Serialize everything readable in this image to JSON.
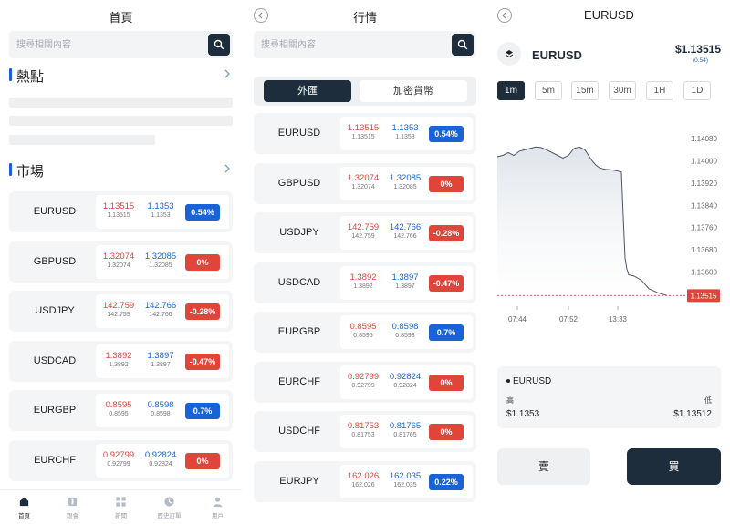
{
  "home": {
    "title": "首頁",
    "search_placeholder": "搜尋相關內容",
    "hot_label": "熱點",
    "market_label": "市場",
    "rows": [
      {
        "symbol": "EURUSD",
        "bid": "1.13515",
        "bid_sub": "1.13515",
        "ask": "1.1353",
        "ask_sub": "1.1353",
        "change": "0.54%",
        "dir": "up"
      },
      {
        "symbol": "GBPUSD",
        "bid": "1.32074",
        "bid_sub": "1.32074",
        "ask": "1.32085",
        "ask_sub": "1.32085",
        "change": "0%",
        "dir": "down"
      },
      {
        "symbol": "USDJPY",
        "bid": "142.759",
        "bid_sub": "142.759",
        "ask": "142.766",
        "ask_sub": "142.766",
        "change": "-0.28%",
        "dir": "down"
      },
      {
        "symbol": "USDCAD",
        "bid": "1.3892",
        "bid_sub": "1.3892",
        "ask": "1.3897",
        "ask_sub": "1.3897",
        "change": "-0.47%",
        "dir": "down"
      },
      {
        "symbol": "EURGBP",
        "bid": "0.8595",
        "bid_sub": "0.8595",
        "ask": "0.8598",
        "ask_sub": "0.8598",
        "change": "0.7%",
        "dir": "up"
      },
      {
        "symbol": "EURCHF",
        "bid": "0.92799",
        "bid_sub": "0.92799",
        "ask": "0.92824",
        "ask_sub": "0.92824",
        "change": "0%",
        "dir": "down"
      }
    ],
    "nav": [
      {
        "label": "首頁",
        "icon": "home-icon"
      },
      {
        "label": "跟會",
        "icon": "follow-icon"
      },
      {
        "label": "新聞",
        "icon": "news-icon"
      },
      {
        "label": "歷史訂單",
        "icon": "history-icon"
      },
      {
        "label": "用戶",
        "icon": "user-icon"
      }
    ]
  },
  "market": {
    "title": "行情",
    "search_placeholder": "搜尋相關內容",
    "tab_forex": "外匯",
    "tab_crypto": "加密貨幣",
    "rows": [
      {
        "symbol": "EURUSD",
        "bid": "1.13515",
        "bid_sub": "1.13515",
        "ask": "1.1353",
        "ask_sub": "1.1353",
        "change": "0.54%",
        "dir": "up"
      },
      {
        "symbol": "GBPUSD",
        "bid": "1.32074",
        "bid_sub": "1.32074",
        "ask": "1.32085",
        "ask_sub": "1.32085",
        "change": "0%",
        "dir": "down"
      },
      {
        "symbol": "USDJPY",
        "bid": "142.759",
        "bid_sub": "142.759",
        "ask": "142.766",
        "ask_sub": "142.766",
        "change": "-0.28%",
        "dir": "down"
      },
      {
        "symbol": "USDCAD",
        "bid": "1.3892",
        "bid_sub": "1.3892",
        "ask": "1.3897",
        "ask_sub": "1.3897",
        "change": "-0.47%",
        "dir": "down"
      },
      {
        "symbol": "EURGBP",
        "bid": "0.8595",
        "bid_sub": "0.8595",
        "ask": "0.8598",
        "ask_sub": "0.8598",
        "change": "0.7%",
        "dir": "up"
      },
      {
        "symbol": "EURCHF",
        "bid": "0.92799",
        "bid_sub": "0.92799",
        "ask": "0.92824",
        "ask_sub": "0.92824",
        "change": "0%",
        "dir": "down"
      },
      {
        "symbol": "USDCHF",
        "bid": "0.81753",
        "bid_sub": "0.81753",
        "ask": "0.81765",
        "ask_sub": "0.81765",
        "change": "0%",
        "dir": "down"
      },
      {
        "symbol": "EURJPY",
        "bid": "162.026",
        "bid_sub": "162.026",
        "ask": "162.035",
        "ask_sub": "162.035",
        "change": "0.22%",
        "dir": "up"
      }
    ]
  },
  "detail": {
    "title": "EURUSD",
    "symbol": "EURUSD",
    "price": "$1.13515",
    "change": "(0.54)",
    "timeframes": [
      "1m",
      "5m",
      "15m",
      "30m",
      "1H",
      "1D"
    ],
    "active_timeframe": "1m",
    "info_title": "EURUSD",
    "high_label": "高",
    "low_label": "低",
    "high_value": "$1.1353",
    "low_value": "$1.13512",
    "sell_label": "賣",
    "buy_label": "買"
  },
  "chart_data": {
    "type": "area",
    "x_labels": [
      "07:44",
      "07:52",
      "13:33"
    ],
    "y_ticks": [
      1.1408,
      1.14,
      1.1392,
      1.1384,
      1.1376,
      1.1368,
      1.136,
      1.13515
    ],
    "y_tick_labels": [
      "1.14080",
      "1.14000",
      "1.13920",
      "1.13840",
      "1.13760",
      "1.13680",
      "1.13600"
    ],
    "current_label": "1.13515",
    "ylim": [
      1.1348,
      1.1412
    ],
    "series": [
      {
        "x": [
          0,
          6,
          12,
          18,
          24,
          30,
          36,
          42,
          48,
          54,
          60,
          66,
          72,
          78,
          84,
          90,
          96,
          100,
          104,
          108,
          112,
          118,
          124,
          130,
          136,
          138,
          140,
          142,
          144,
          150,
          158,
          166,
          176,
          186
        ],
        "y": [
          1.14015,
          1.1402,
          1.1403,
          1.1402,
          1.14035,
          1.1404,
          1.14045,
          1.1405,
          1.14048,
          1.1404,
          1.1403,
          1.1402,
          1.1401,
          1.1402,
          1.14045,
          1.1405,
          1.1404,
          1.1402,
          1.14,
          1.13985,
          1.13975,
          1.1397,
          1.13968,
          1.13965,
          1.1396,
          1.138,
          1.1365,
          1.1361,
          1.1359,
          1.13585,
          1.1357,
          1.1354,
          1.13525,
          1.13515
        ]
      }
    ]
  }
}
